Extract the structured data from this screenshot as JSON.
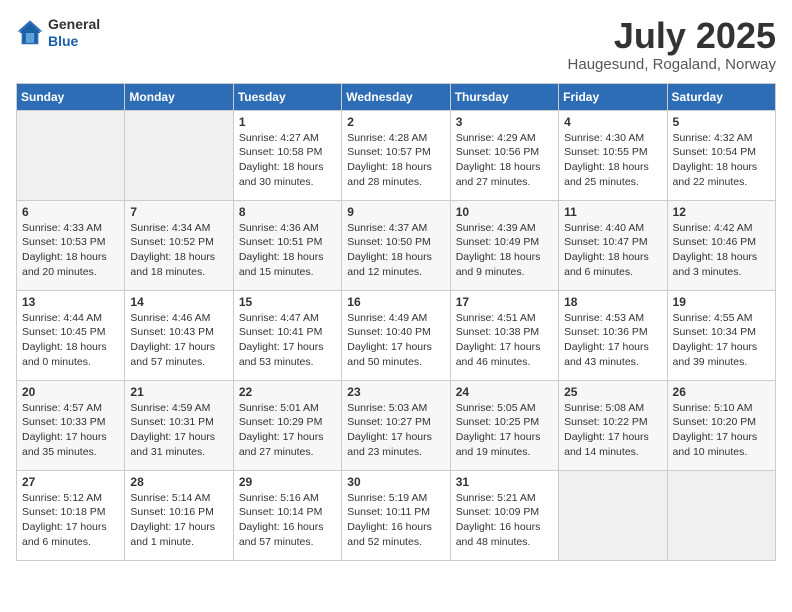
{
  "header": {
    "logo_general": "General",
    "logo_blue": "Blue",
    "month_title": "July 2025",
    "location": "Haugesund, Rogaland, Norway"
  },
  "calendar": {
    "days_of_week": [
      "Sunday",
      "Monday",
      "Tuesday",
      "Wednesday",
      "Thursday",
      "Friday",
      "Saturday"
    ],
    "weeks": [
      [
        {
          "day": "",
          "info": ""
        },
        {
          "day": "",
          "info": ""
        },
        {
          "day": "1",
          "info": "Sunrise: 4:27 AM\nSunset: 10:58 PM\nDaylight: 18 hours\nand 30 minutes."
        },
        {
          "day": "2",
          "info": "Sunrise: 4:28 AM\nSunset: 10:57 PM\nDaylight: 18 hours\nand 28 minutes."
        },
        {
          "day": "3",
          "info": "Sunrise: 4:29 AM\nSunset: 10:56 PM\nDaylight: 18 hours\nand 27 minutes."
        },
        {
          "day": "4",
          "info": "Sunrise: 4:30 AM\nSunset: 10:55 PM\nDaylight: 18 hours\nand 25 minutes."
        },
        {
          "day": "5",
          "info": "Sunrise: 4:32 AM\nSunset: 10:54 PM\nDaylight: 18 hours\nand 22 minutes."
        }
      ],
      [
        {
          "day": "6",
          "info": "Sunrise: 4:33 AM\nSunset: 10:53 PM\nDaylight: 18 hours\nand 20 minutes."
        },
        {
          "day": "7",
          "info": "Sunrise: 4:34 AM\nSunset: 10:52 PM\nDaylight: 18 hours\nand 18 minutes."
        },
        {
          "day": "8",
          "info": "Sunrise: 4:36 AM\nSunset: 10:51 PM\nDaylight: 18 hours\nand 15 minutes."
        },
        {
          "day": "9",
          "info": "Sunrise: 4:37 AM\nSunset: 10:50 PM\nDaylight: 18 hours\nand 12 minutes."
        },
        {
          "day": "10",
          "info": "Sunrise: 4:39 AM\nSunset: 10:49 PM\nDaylight: 18 hours\nand 9 minutes."
        },
        {
          "day": "11",
          "info": "Sunrise: 4:40 AM\nSunset: 10:47 PM\nDaylight: 18 hours\nand 6 minutes."
        },
        {
          "day": "12",
          "info": "Sunrise: 4:42 AM\nSunset: 10:46 PM\nDaylight: 18 hours\nand 3 minutes."
        }
      ],
      [
        {
          "day": "13",
          "info": "Sunrise: 4:44 AM\nSunset: 10:45 PM\nDaylight: 18 hours\nand 0 minutes."
        },
        {
          "day": "14",
          "info": "Sunrise: 4:46 AM\nSunset: 10:43 PM\nDaylight: 17 hours\nand 57 minutes."
        },
        {
          "day": "15",
          "info": "Sunrise: 4:47 AM\nSunset: 10:41 PM\nDaylight: 17 hours\nand 53 minutes."
        },
        {
          "day": "16",
          "info": "Sunrise: 4:49 AM\nSunset: 10:40 PM\nDaylight: 17 hours\nand 50 minutes."
        },
        {
          "day": "17",
          "info": "Sunrise: 4:51 AM\nSunset: 10:38 PM\nDaylight: 17 hours\nand 46 minutes."
        },
        {
          "day": "18",
          "info": "Sunrise: 4:53 AM\nSunset: 10:36 PM\nDaylight: 17 hours\nand 43 minutes."
        },
        {
          "day": "19",
          "info": "Sunrise: 4:55 AM\nSunset: 10:34 PM\nDaylight: 17 hours\nand 39 minutes."
        }
      ],
      [
        {
          "day": "20",
          "info": "Sunrise: 4:57 AM\nSunset: 10:33 PM\nDaylight: 17 hours\nand 35 minutes."
        },
        {
          "day": "21",
          "info": "Sunrise: 4:59 AM\nSunset: 10:31 PM\nDaylight: 17 hours\nand 31 minutes."
        },
        {
          "day": "22",
          "info": "Sunrise: 5:01 AM\nSunset: 10:29 PM\nDaylight: 17 hours\nand 27 minutes."
        },
        {
          "day": "23",
          "info": "Sunrise: 5:03 AM\nSunset: 10:27 PM\nDaylight: 17 hours\nand 23 minutes."
        },
        {
          "day": "24",
          "info": "Sunrise: 5:05 AM\nSunset: 10:25 PM\nDaylight: 17 hours\nand 19 minutes."
        },
        {
          "day": "25",
          "info": "Sunrise: 5:08 AM\nSunset: 10:22 PM\nDaylight: 17 hours\nand 14 minutes."
        },
        {
          "day": "26",
          "info": "Sunrise: 5:10 AM\nSunset: 10:20 PM\nDaylight: 17 hours\nand 10 minutes."
        }
      ],
      [
        {
          "day": "27",
          "info": "Sunrise: 5:12 AM\nSunset: 10:18 PM\nDaylight: 17 hours\nand 6 minutes."
        },
        {
          "day": "28",
          "info": "Sunrise: 5:14 AM\nSunset: 10:16 PM\nDaylight: 17 hours\nand 1 minute."
        },
        {
          "day": "29",
          "info": "Sunrise: 5:16 AM\nSunset: 10:14 PM\nDaylight: 16 hours\nand 57 minutes."
        },
        {
          "day": "30",
          "info": "Sunrise: 5:19 AM\nSunset: 10:11 PM\nDaylight: 16 hours\nand 52 minutes."
        },
        {
          "day": "31",
          "info": "Sunrise: 5:21 AM\nSunset: 10:09 PM\nDaylight: 16 hours\nand 48 minutes."
        },
        {
          "day": "",
          "info": ""
        },
        {
          "day": "",
          "info": ""
        }
      ]
    ]
  }
}
